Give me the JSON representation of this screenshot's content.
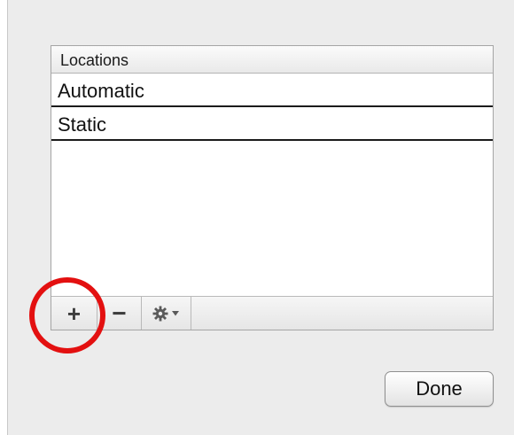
{
  "locations_table": {
    "header": "Locations",
    "rows": [
      {
        "label": "Automatic"
      },
      {
        "label": "Static"
      }
    ]
  },
  "toolbar": {
    "add_label": "+",
    "remove_label": "−",
    "action_icon": "gear-icon",
    "action_dropdown_icon": "triangle-down-icon"
  },
  "annotation": {
    "highlight_color": "#e31010",
    "target": "add-location-button"
  },
  "footer": {
    "done_label": "Done"
  }
}
